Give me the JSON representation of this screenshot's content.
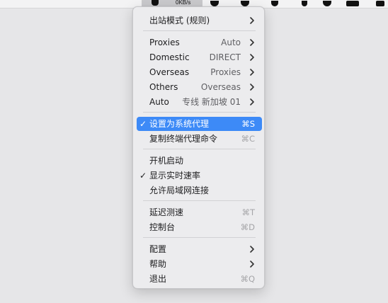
{
  "menubar": {
    "traffic_text": "0KB/s"
  },
  "menu": {
    "outbound_mode": {
      "label": "出站模式 (规则)"
    },
    "proxies_groups": [
      {
        "label": "Proxies",
        "value": "Auto"
      },
      {
        "label": "Domestic",
        "value": "DIRECT"
      },
      {
        "label": "Overseas",
        "value": "Proxies"
      },
      {
        "label": "Others",
        "value": "Overseas"
      },
      {
        "label": "Auto",
        "value": "专线 新加坡 01"
      }
    ],
    "system_proxy": {
      "check": "✓",
      "label": "设置为系统代理",
      "shortcut": "⌘S"
    },
    "copy_command": {
      "label": "复制终端代理命令",
      "shortcut": "⌘C"
    },
    "launch_at_login": {
      "label": "开机启动"
    },
    "show_speed": {
      "check": "✓",
      "label": "显示实时速率"
    },
    "allow_lan": {
      "label": "允许局域网连接"
    },
    "latency_test": {
      "label": "延迟测速",
      "shortcut": "⌘T"
    },
    "dashboard": {
      "label": "控制台",
      "shortcut": "⌘D"
    },
    "config": {
      "label": "配置"
    },
    "help": {
      "label": "帮助"
    },
    "quit": {
      "label": "退出",
      "shortcut": "⌘Q"
    }
  },
  "colors": {
    "highlight": "#3d8af7",
    "menu_bg": "#ececee",
    "shortcut_gray": "#a5a5a8"
  }
}
